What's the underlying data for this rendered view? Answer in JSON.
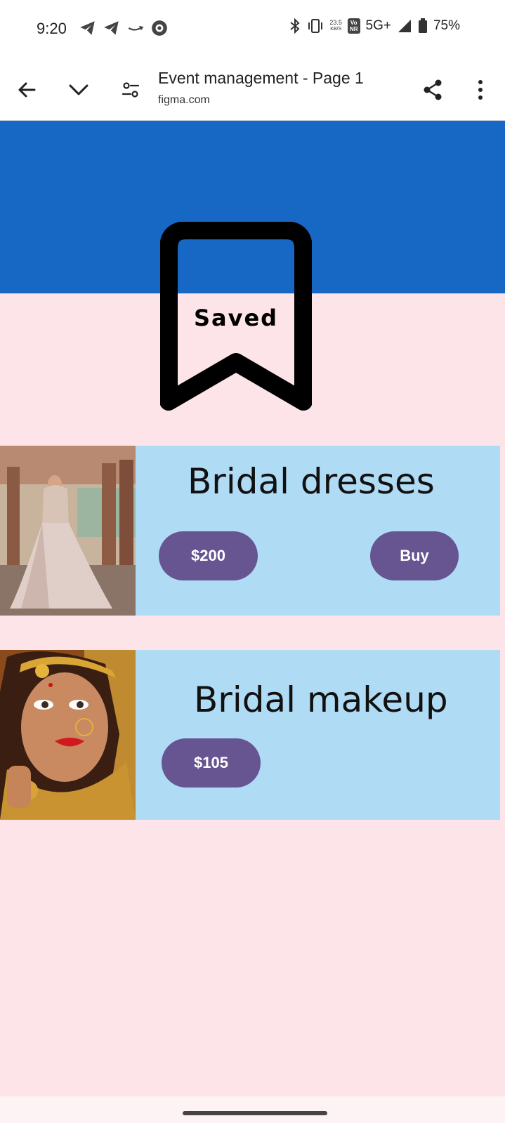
{
  "status_bar": {
    "time": "9:20",
    "speed_value": "23.5",
    "speed_unit": "KB/S",
    "volte_top": "Vo",
    "volte_bottom": "NR",
    "network": "5G+",
    "battery": "75%",
    "left_icons": [
      "telegram-icon",
      "telegram-icon",
      "amazon-icon",
      "app-icon"
    ],
    "right_icons": [
      "bluetooth-icon",
      "vibrate-icon",
      "signal-icon",
      "battery-icon"
    ]
  },
  "browser": {
    "page_title": "Event management - Page 1",
    "url": "figma.com"
  },
  "page": {
    "header_color": "#1767c5",
    "background_color": "#fce4e8",
    "saved_label": "Saved"
  },
  "items": [
    {
      "title": "Bridal dresses",
      "price": "$200",
      "buy_label": "Buy"
    },
    {
      "title": "Bridal makeup",
      "price": "$105"
    }
  ],
  "colors": {
    "card": "#b0dbf5",
    "button": "#665591"
  }
}
